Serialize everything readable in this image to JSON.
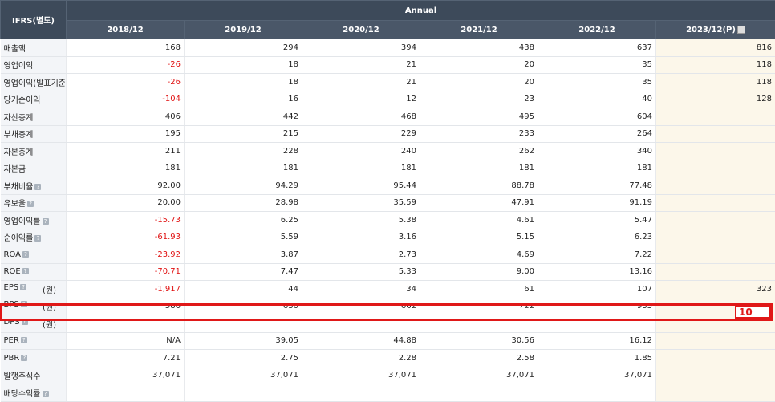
{
  "header": {
    "corner": "IFRS(별도)",
    "group": "Annual",
    "years": [
      "2018/12",
      "2019/12",
      "2020/12",
      "2021/12",
      "2022/12",
      "2023/12(P)"
    ]
  },
  "rows": [
    {
      "label": "매출액",
      "help": false,
      "unit": "",
      "values": [
        "168",
        "294",
        "394",
        "438",
        "637",
        "816"
      ]
    },
    {
      "label": "영업이익",
      "help": false,
      "unit": "",
      "values": [
        "-26",
        "18",
        "21",
        "20",
        "35",
        "118"
      ]
    },
    {
      "label": "영업이익(발표기준)",
      "help": false,
      "unit": "",
      "values": [
        "-26",
        "18",
        "21",
        "20",
        "35",
        "118"
      ]
    },
    {
      "label": "당기순이익",
      "help": false,
      "unit": "",
      "values": [
        "-104",
        "16",
        "12",
        "23",
        "40",
        "128"
      ]
    },
    {
      "label": "자산총계",
      "help": false,
      "unit": "",
      "values": [
        "406",
        "442",
        "468",
        "495",
        "604",
        ""
      ]
    },
    {
      "label": "부채총계",
      "help": false,
      "unit": "",
      "values": [
        "195",
        "215",
        "229",
        "233",
        "264",
        ""
      ]
    },
    {
      "label": "자본총계",
      "help": false,
      "unit": "",
      "values": [
        "211",
        "228",
        "240",
        "262",
        "340",
        ""
      ]
    },
    {
      "label": "자본금",
      "help": false,
      "unit": "",
      "values": [
        "181",
        "181",
        "181",
        "181",
        "181",
        ""
      ]
    },
    {
      "label": "부채비율",
      "help": true,
      "unit": "",
      "values": [
        "92.00",
        "94.29",
        "95.44",
        "88.78",
        "77.48",
        ""
      ]
    },
    {
      "label": "유보율",
      "help": true,
      "unit": "",
      "values": [
        "20.00",
        "28.98",
        "35.59",
        "47.91",
        "91.19",
        ""
      ]
    },
    {
      "label": "영업이익률",
      "help": true,
      "unit": "",
      "values": [
        "-15.73",
        "6.25",
        "5.38",
        "4.61",
        "5.47",
        ""
      ]
    },
    {
      "label": "순이익률",
      "help": true,
      "unit": "",
      "values": [
        "-61.93",
        "5.59",
        "3.16",
        "5.15",
        "6.23",
        ""
      ]
    },
    {
      "label": "ROA",
      "help": true,
      "unit": "",
      "values": [
        "-23.92",
        "3.87",
        "2.73",
        "4.69",
        "7.22",
        ""
      ]
    },
    {
      "label": "ROE",
      "help": true,
      "unit": "",
      "values": [
        "-70.71",
        "7.47",
        "5.33",
        "9.00",
        "13.16",
        ""
      ]
    },
    {
      "label": "EPS",
      "help": true,
      "unit": "(원)",
      "values": [
        "-1,917",
        "44",
        "34",
        "61",
        "107",
        "323"
      ]
    },
    {
      "label": "BPS",
      "help": true,
      "unit": "(원)",
      "values": [
        "586",
        "630",
        "662",
        "722",
        "933",
        ""
      ]
    },
    {
      "label": "DPS",
      "help": true,
      "unit": "(원)",
      "values": [
        "",
        "",
        "",
        "",
        "",
        ""
      ]
    },
    {
      "label": "PER",
      "help": true,
      "unit": "",
      "values": [
        "N/A",
        "39.05",
        "44.88",
        "30.56",
        "16.12",
        ""
      ]
    },
    {
      "label": "PBR",
      "help": true,
      "unit": "",
      "values": [
        "7.21",
        "2.75",
        "2.28",
        "2.58",
        "1.85",
        ""
      ]
    },
    {
      "label": "발행주식수",
      "help": false,
      "unit": "",
      "values": [
        "37,071",
        "37,071",
        "37,071",
        "37,071",
        "37,071",
        ""
      ]
    },
    {
      "label": "배당수익률",
      "help": true,
      "unit": "",
      "values": [
        "",
        "",
        "",
        "",
        "",
        ""
      ]
    }
  ],
  "highlight": {
    "label": "10"
  },
  "help_glyph": "?",
  "colors": {
    "header_bg": "#3d4a5a",
    "negative": "#e01010",
    "estimate_bg": "#fcf7ea",
    "highlight": "#e01818"
  }
}
